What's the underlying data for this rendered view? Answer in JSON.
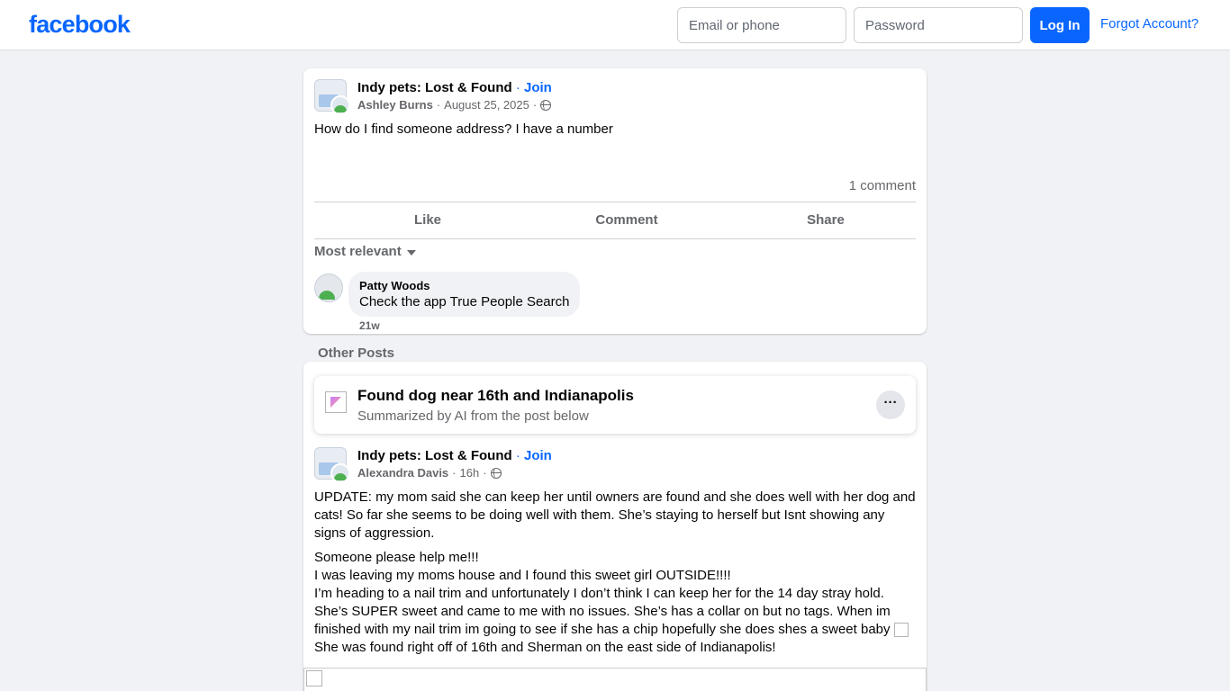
{
  "header": {
    "logo": "facebook",
    "email_placeholder": "Email or phone",
    "password_placeholder": "Password",
    "login_label": "Log In",
    "forgot_label": "Forgot Account?"
  },
  "post1": {
    "group_name": "Indy pets: Lost & Found",
    "separator": "·",
    "join_label": "Join",
    "author": "Ashley Burns",
    "date": "August 25, 2025",
    "dot": "·",
    "text": "How do I find someone address? I have a number",
    "comment_count": "1 comment",
    "actions": {
      "like": "Like",
      "comment": "Comment",
      "share": "Share"
    },
    "sort_label": "Most relevant",
    "comment": {
      "name": "Patty Woods",
      "text": "Check the app True People Search",
      "time": "21w"
    }
  },
  "other_posts_label": "Other Posts",
  "post2": {
    "ai_title": "Found dog near 16th and Indianapolis",
    "ai_subtitle": "Summarized by AI from the post below",
    "more_label": "···",
    "group_name": "Indy pets: Lost & Found",
    "separator": "·",
    "join_label": "Join",
    "author": "Alexandra Davis",
    "time": "16h",
    "dot": "·",
    "paragraph1": "UPDATE: my mom said she can keep her until owners are found and she does well with her dog and cats! So far she seems to be doing well with them. She’s staying to herself but Isnt showing any signs of aggression.",
    "lines": [
      "Someone please help me!!!",
      "I was leaving my moms house and I found this sweet girl OUTSIDE!!!!",
      "I’m heading to a nail trim and unfortunately I don’t think I can keep her for the 14 day stray hold. She’s SUPER sweet and came to me with no issues. She’s has a collar on but no tags. When im finished with my nail trim im going to see if she has a chip hopefully she does shes a sweet baby",
      "She was found right off of 16th and Sherman on the east side of Indianapolis!"
    ]
  }
}
